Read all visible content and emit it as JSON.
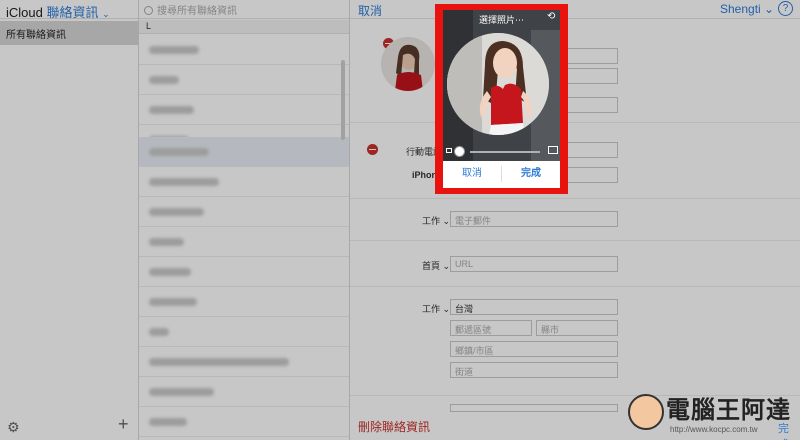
{
  "groups": {
    "brand_icloud": "iCloud",
    "brand_app": "聯絡資訊",
    "brand_chevron": "⌄",
    "selected_group": "所有聯絡資訊"
  },
  "list": {
    "search_placeholder": "搜尋所有聯絡資訊",
    "section_letter": "L"
  },
  "card": {
    "cancel_label": "取消",
    "user_label": "Shengti ⌄",
    "help_label": "?",
    "mobile_label": "行動電話",
    "iphone_label": "iPhone",
    "email_label": "工作 ⌄",
    "email_placeholder": "電子郵件",
    "url_label": "首頁 ⌄",
    "url_placeholder": "URL",
    "address_label": "工作 ⌄",
    "country_value": "台灣",
    "postal_placeholder": "郵遞區號",
    "city_placeholder": "縣市",
    "district_placeholder": "鄉鎮/市區",
    "street_placeholder": "街道",
    "delete_label": "刪除聯絡資訊"
  },
  "picker": {
    "title": "選擇照片⋯",
    "cancel_label": "取消",
    "done_label": "完成"
  },
  "watermark": {
    "title": "電腦王阿達",
    "url": "http://www.kocpc.com.tw",
    "done_label": "完成"
  },
  "colors": {
    "accent": "#2f7bd6",
    "destructive": "#c9302c",
    "highlight_frame": "#e8120f"
  }
}
